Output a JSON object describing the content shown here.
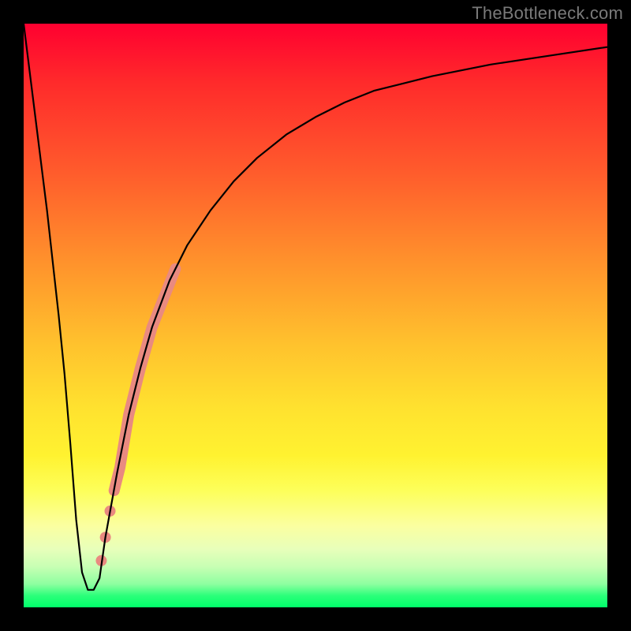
{
  "watermark": "TheBottleneck.com",
  "chart_data": {
    "type": "line",
    "title": "",
    "xlabel": "",
    "ylabel": "",
    "xlim": [
      0,
      100
    ],
    "ylim": [
      0,
      100
    ],
    "background_gradient_stops": [
      {
        "pct": 0,
        "color": "#ff0030"
      },
      {
        "pct": 10,
        "color": "#ff2a2b"
      },
      {
        "pct": 25,
        "color": "#ff5a2c"
      },
      {
        "pct": 40,
        "color": "#ff8f2c"
      },
      {
        "pct": 55,
        "color": "#ffc22d"
      },
      {
        "pct": 66,
        "color": "#ffe22f"
      },
      {
        "pct": 74,
        "color": "#fff230"
      },
      {
        "pct": 80,
        "color": "#fdff5a"
      },
      {
        "pct": 86,
        "color": "#fbffa0"
      },
      {
        "pct": 90,
        "color": "#e8ffba"
      },
      {
        "pct": 93,
        "color": "#c8ffb4"
      },
      {
        "pct": 96,
        "color": "#8effa0"
      },
      {
        "pct": 98,
        "color": "#2bff7a"
      },
      {
        "pct": 100,
        "color": "#00ff6a"
      }
    ],
    "series": [
      {
        "name": "bottleneck-curve",
        "color": "#000000",
        "stroke_width": 2.2,
        "x": [
          0,
          2,
          4,
          6,
          7,
          8,
          9,
          10,
          11,
          12,
          13,
          14,
          16,
          18,
          20,
          22,
          25,
          28,
          32,
          36,
          40,
          45,
          50,
          55,
          60,
          70,
          80,
          90,
          100
        ],
        "y": [
          100,
          84,
          68,
          50,
          40,
          28,
          15,
          6,
          3,
          3,
          5,
          12,
          23,
          33,
          41,
          48,
          56,
          62,
          68,
          73,
          77,
          81,
          84,
          86.5,
          88.5,
          91,
          93,
          94.5,
          96
        ]
      }
    ],
    "highlight_segment": {
      "name": "highlighted-range",
      "color": "#e98a80",
      "stroke_width": 14,
      "x": [
        15.5,
        16.5,
        18,
        20,
        22,
        24,
        26
      ],
      "y": [
        20,
        24,
        33,
        41,
        48,
        53,
        58
      ]
    },
    "highlight_dots": {
      "name": "highlighted-dots",
      "color": "#e98a80",
      "radius": 7,
      "points": [
        {
          "x": 14.8,
          "y": 16.5
        },
        {
          "x": 14.0,
          "y": 12.0
        },
        {
          "x": 13.3,
          "y": 8.0
        }
      ]
    }
  }
}
